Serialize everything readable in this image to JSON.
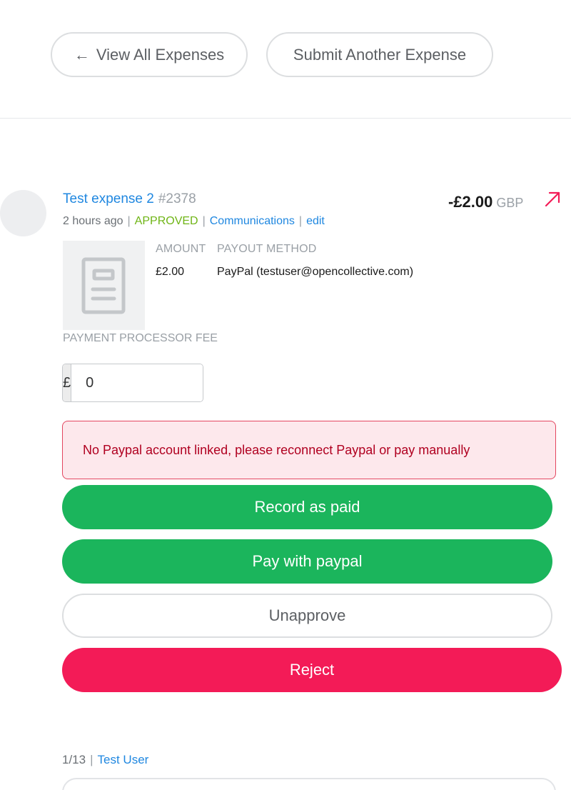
{
  "top_actions": {
    "view_all_label": "View All Expenses",
    "submit_another_label": "Submit Another Expense"
  },
  "expense": {
    "title": "Test expense 2",
    "id": "#2378",
    "time_ago": "2 hours ago",
    "status": "APPROVED",
    "communications_label": "Communications",
    "edit_label": "edit",
    "total_amount": "-£2.00",
    "total_currency": "GBP",
    "amount_header": "AMOUNT",
    "payout_header": "PAYOUT METHOD",
    "amount_value": "£2.00",
    "payout_value": "PayPal (testuser@opencollective.com)"
  },
  "fee": {
    "label": "PAYMENT PROCESSOR FEE",
    "currency_symbol": "£",
    "value": "0"
  },
  "alert": {
    "message": "No Paypal account linked, please reconnect Paypal or pay manually"
  },
  "actions": {
    "record_paid": "Record as paid",
    "pay_paypal": "Pay with paypal",
    "unapprove": "Unapprove",
    "reject": "Reject"
  },
  "pager": {
    "count": "1/13",
    "user": "Test User"
  },
  "colors": {
    "link": "#1f87e0",
    "approved": "#6fb516",
    "success": "#1bb55c",
    "danger": "#f31b57",
    "alert_bg": "#fde8ec"
  }
}
